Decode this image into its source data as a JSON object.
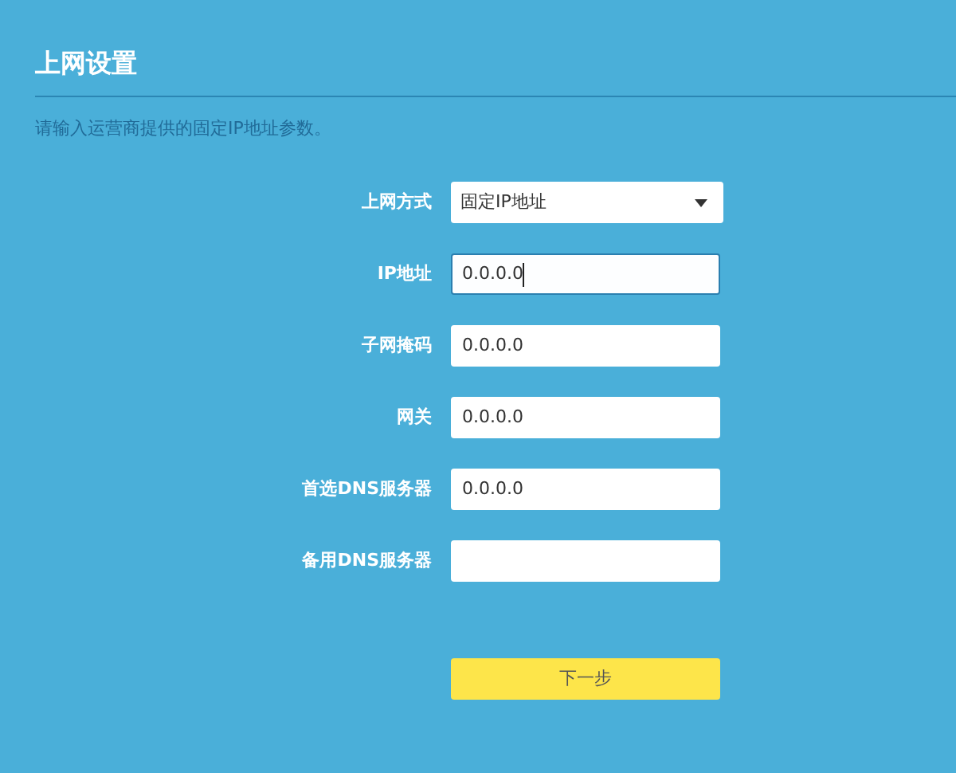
{
  "title": "上网设置",
  "description": "请输入运营商提供的固定IP地址参数。",
  "fields": [
    {
      "label": "上网方式",
      "kind": "select",
      "value": "固定IP地址",
      "focused": false
    },
    {
      "label": "IP地址",
      "kind": "text",
      "value": "0.0.0.0",
      "focused": true
    },
    {
      "label": "子网掩码",
      "kind": "text",
      "value": "0.0.0.0",
      "focused": false
    },
    {
      "label": "网关",
      "kind": "text",
      "value": "0.0.0.0",
      "focused": false
    },
    {
      "label": "首选DNS服务器",
      "kind": "text",
      "value": "0.0.0.0",
      "focused": false
    },
    {
      "label": "备用DNS服务器",
      "kind": "text",
      "focused": false
    }
  ],
  "next_button": "下一步"
}
